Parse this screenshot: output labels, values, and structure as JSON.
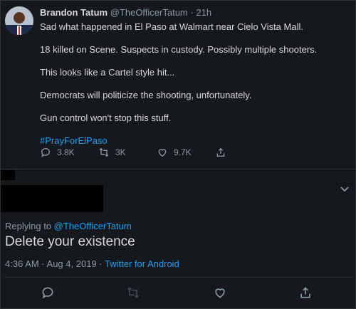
{
  "original_tweet": {
    "author_name": "Brandon Tatum",
    "author_handle": "@TheOfficerTatum",
    "separator": "·",
    "time": "21h",
    "paragraphs": [
      "Sad what happened in El Paso at Walmart near Cielo Vista Mall.",
      "18 killed on Scene. Suspects in custody. Possibly multiple shooters.",
      "This looks like a Cartel style hit...",
      "Democrats will politicize the shooting, unfortunately.",
      "Gun control won't stop this stuff."
    ],
    "hashtag": "#PrayForElPaso",
    "reply_count": "3.8K",
    "retweet_count": "3K",
    "like_count": "9.7K"
  },
  "reply": {
    "replying_to_label": "Replying to",
    "replying_to_handle": "@TheOfficerTatum",
    "text": "Delete your existence",
    "timestamp": "4:36 AM · Aug 4, 2019",
    "separator": "·",
    "source": "Twitter for Android"
  },
  "icons": {
    "reply": "reply-icon",
    "retweet": "retweet-icon",
    "like": "like-icon",
    "share": "share-icon",
    "chevron": "chevron-down-icon"
  },
  "colors": {
    "background": "#15181c",
    "link": "#1da1f2",
    "muted": "#8899a6",
    "text": "#d9d9d9"
  }
}
